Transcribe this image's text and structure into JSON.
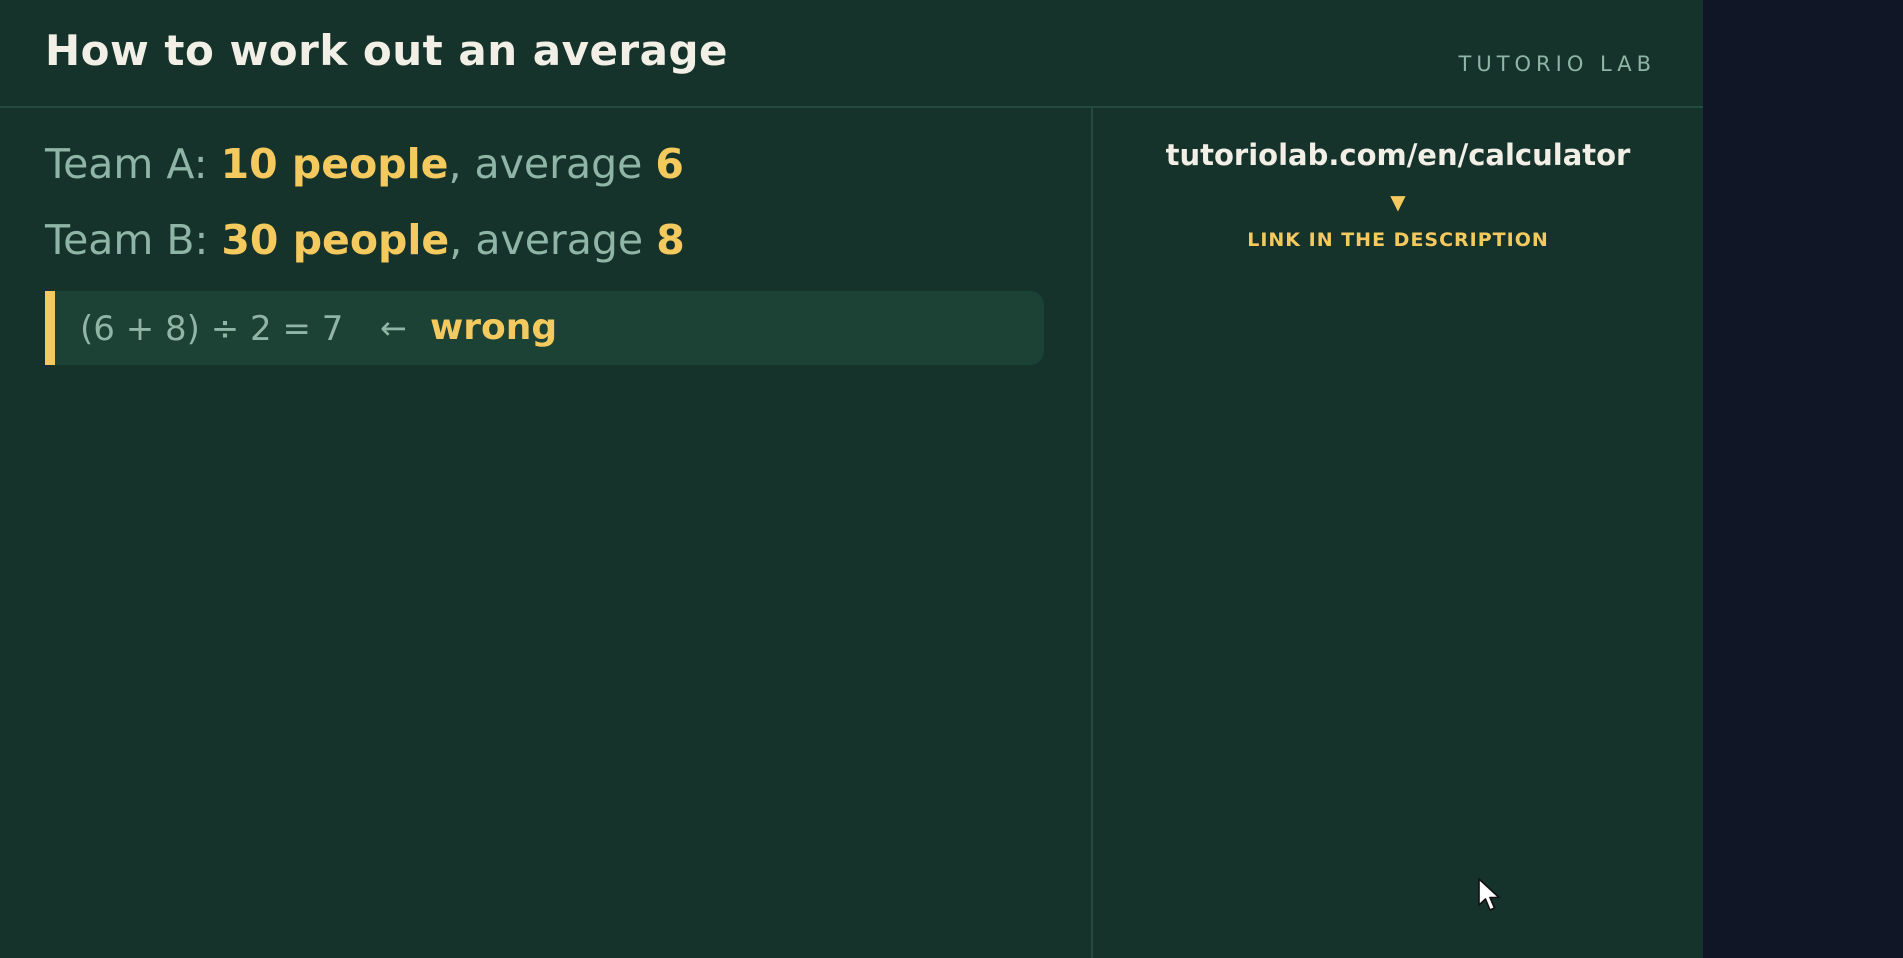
{
  "header": {
    "title": "How to work out an average",
    "brand": "TUTORIO LAB"
  },
  "main": {
    "team_a": {
      "label": "Team A: ",
      "people": "10 people",
      "middle": ", average ",
      "average": "6"
    },
    "team_b": {
      "label": "Team B: ",
      "people": "30 people",
      "middle": ", average ",
      "average": "8"
    },
    "callout": {
      "formula": "(6 + 8) ÷ 2 = 7",
      "arrow": "←",
      "verdict": "wrong"
    }
  },
  "side": {
    "url": "tutoriolab.com/en/calculator",
    "arrow": "▼",
    "note": "LINK IN THE DESCRIPTION"
  },
  "colors": {
    "board": "#16332b",
    "accent": "#f4c95d",
    "muted_text": "#8fb5a6",
    "title_text": "#f1efe6",
    "outer_background": "#101626"
  },
  "icons": {
    "cursor": "mouse-pointer-icon"
  }
}
